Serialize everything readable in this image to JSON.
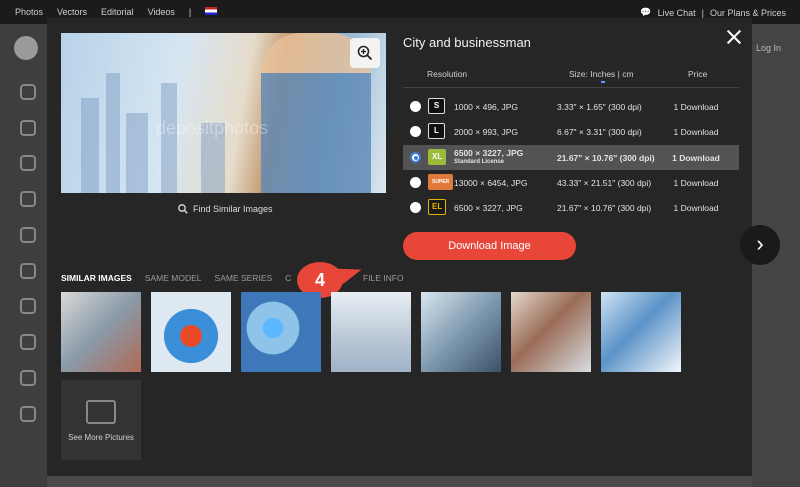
{
  "topbar": {
    "nav": [
      "Photos",
      "Vectors",
      "Editorial",
      "Videos",
      "|"
    ],
    "live_chat": "Live Chat",
    "separator": "|",
    "plans": "Our Plans & Prices"
  },
  "background": {
    "login_label": "Log In"
  },
  "modal": {
    "title": "City and businessman",
    "preview_watermark": "depositphotos",
    "find_similar": "Find Similar Images",
    "table_headers": {
      "resolution": "Resolution",
      "size": "Size: Inches | cm",
      "price": "Price"
    },
    "rows": [
      {
        "badge": "S",
        "resolution": "1000 × 496, JPG",
        "license": "",
        "size": "3.33\" × 1.65\" (300 dpi)",
        "price": "1 Download",
        "selected": false
      },
      {
        "badge": "L",
        "resolution": "2000 × 993, JPG",
        "license": "",
        "size": "6.67\" × 3.31\" (300 dpi)",
        "price": "1 Download",
        "selected": false
      },
      {
        "badge": "XL",
        "resolution": "6500 × 3227, JPG",
        "license": "Standard License",
        "size": "21.67\" × 10.76\" (300 dpi)",
        "price": "1 Download",
        "selected": true
      },
      {
        "badge": "SUPER",
        "resolution": "13000 × 6454, JPG",
        "license": "",
        "size": "43.33\" × 21.51\" (300 dpi)",
        "price": "1 Download",
        "selected": false
      },
      {
        "badge": "EL",
        "resolution": "6500 × 3227, JPG",
        "license": "",
        "size": "21.67\" × 10.76\" (300 dpi)",
        "price": "1 Download",
        "selected": false
      }
    ],
    "download_label": "Download Image",
    "tabs": [
      "SIMILAR IMAGES",
      "SAME MODEL",
      "SAME SERIES",
      "C"
    ],
    "file_info_tab": "FILE INFO",
    "step_number": "4",
    "see_more": "See More Pictures"
  },
  "colors": {
    "accent": "#e9463a",
    "modal_bg": "#262626",
    "selected_row": "#535353",
    "radio_selected": "#3c7bd6"
  }
}
